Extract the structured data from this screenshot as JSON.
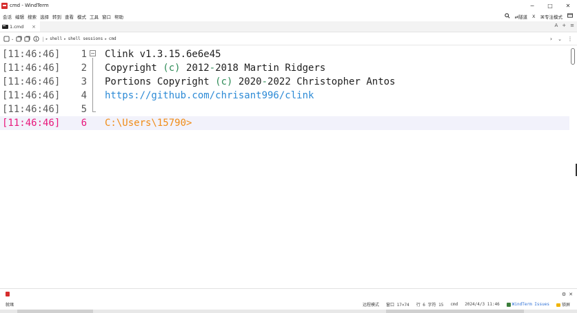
{
  "window": {
    "title": "cmd - WindTerm",
    "controls": [
      "−",
      "□",
      "✕"
    ]
  },
  "menubar": {
    "items": [
      "会话",
      "编辑",
      "搜索",
      "选择",
      "转到",
      "查看",
      "模式",
      "工具",
      "窗口",
      "帮助"
    ],
    "right": {
      "search_icon": "search-icon",
      "relay": "隧道",
      "x_label": "X",
      "focus_mode": "专注模式",
      "lock_icon": "window-icon"
    }
  },
  "tabs": [
    {
      "label": "1.cmd",
      "active": true
    }
  ],
  "tabbar_right": {
    "font": "A",
    "add": "+",
    "menu": "≡"
  },
  "addressbar": {
    "breadcrumbs": [
      "shell",
      "shell sessions",
      "cmd"
    ],
    "right_arrow": "›",
    "dropdown": "⌄",
    "more": "⋮"
  },
  "terminal": {
    "lines": [
      {
        "timestamp": "[11:46:46]",
        "number": "1",
        "text": "Clink v1.3.15.6e6e45"
      },
      {
        "timestamp": "[11:46:46]",
        "number": "2",
        "parts": [
          "Copyright ",
          "(c)",
          " 2012",
          "-",
          "2018 Martin Ridgers"
        ]
      },
      {
        "timestamp": "[11:46:46]",
        "number": "3",
        "parts": [
          "Portions Copyright ",
          "(c)",
          " 2020",
          "-",
          "2022 Christopher Antos"
        ]
      },
      {
        "timestamp": "[11:46:46]",
        "number": "4",
        "text": "https://github.com/chrisant996/clink"
      },
      {
        "timestamp": "[11:46:46]",
        "number": "5",
        "text": ""
      },
      {
        "timestamp": "[11:46:46]",
        "number": "6",
        "text": "C:\\Users\\15790>"
      }
    ],
    "current_line": 6
  },
  "bottom_panel": {
    "right": [
      "⚙",
      "✕"
    ]
  },
  "statusbar": {
    "left": "就绪",
    "remote_mode": "远程模式",
    "window_size": "窗口 17×74",
    "position": "行 6  字符 15",
    "shell": "cmd",
    "datetime": "2024/4/3 11:46",
    "issues": "WindTerm Issues",
    "lock": "锁屏"
  },
  "colors": {
    "timestamp_current": "#e8177b",
    "link": "#2c8ad6",
    "prompt": "#f08c17",
    "current_line_bg": "#f2f2fb",
    "paren": "#2e8b57",
    "app_icon": "#d62d2d"
  }
}
